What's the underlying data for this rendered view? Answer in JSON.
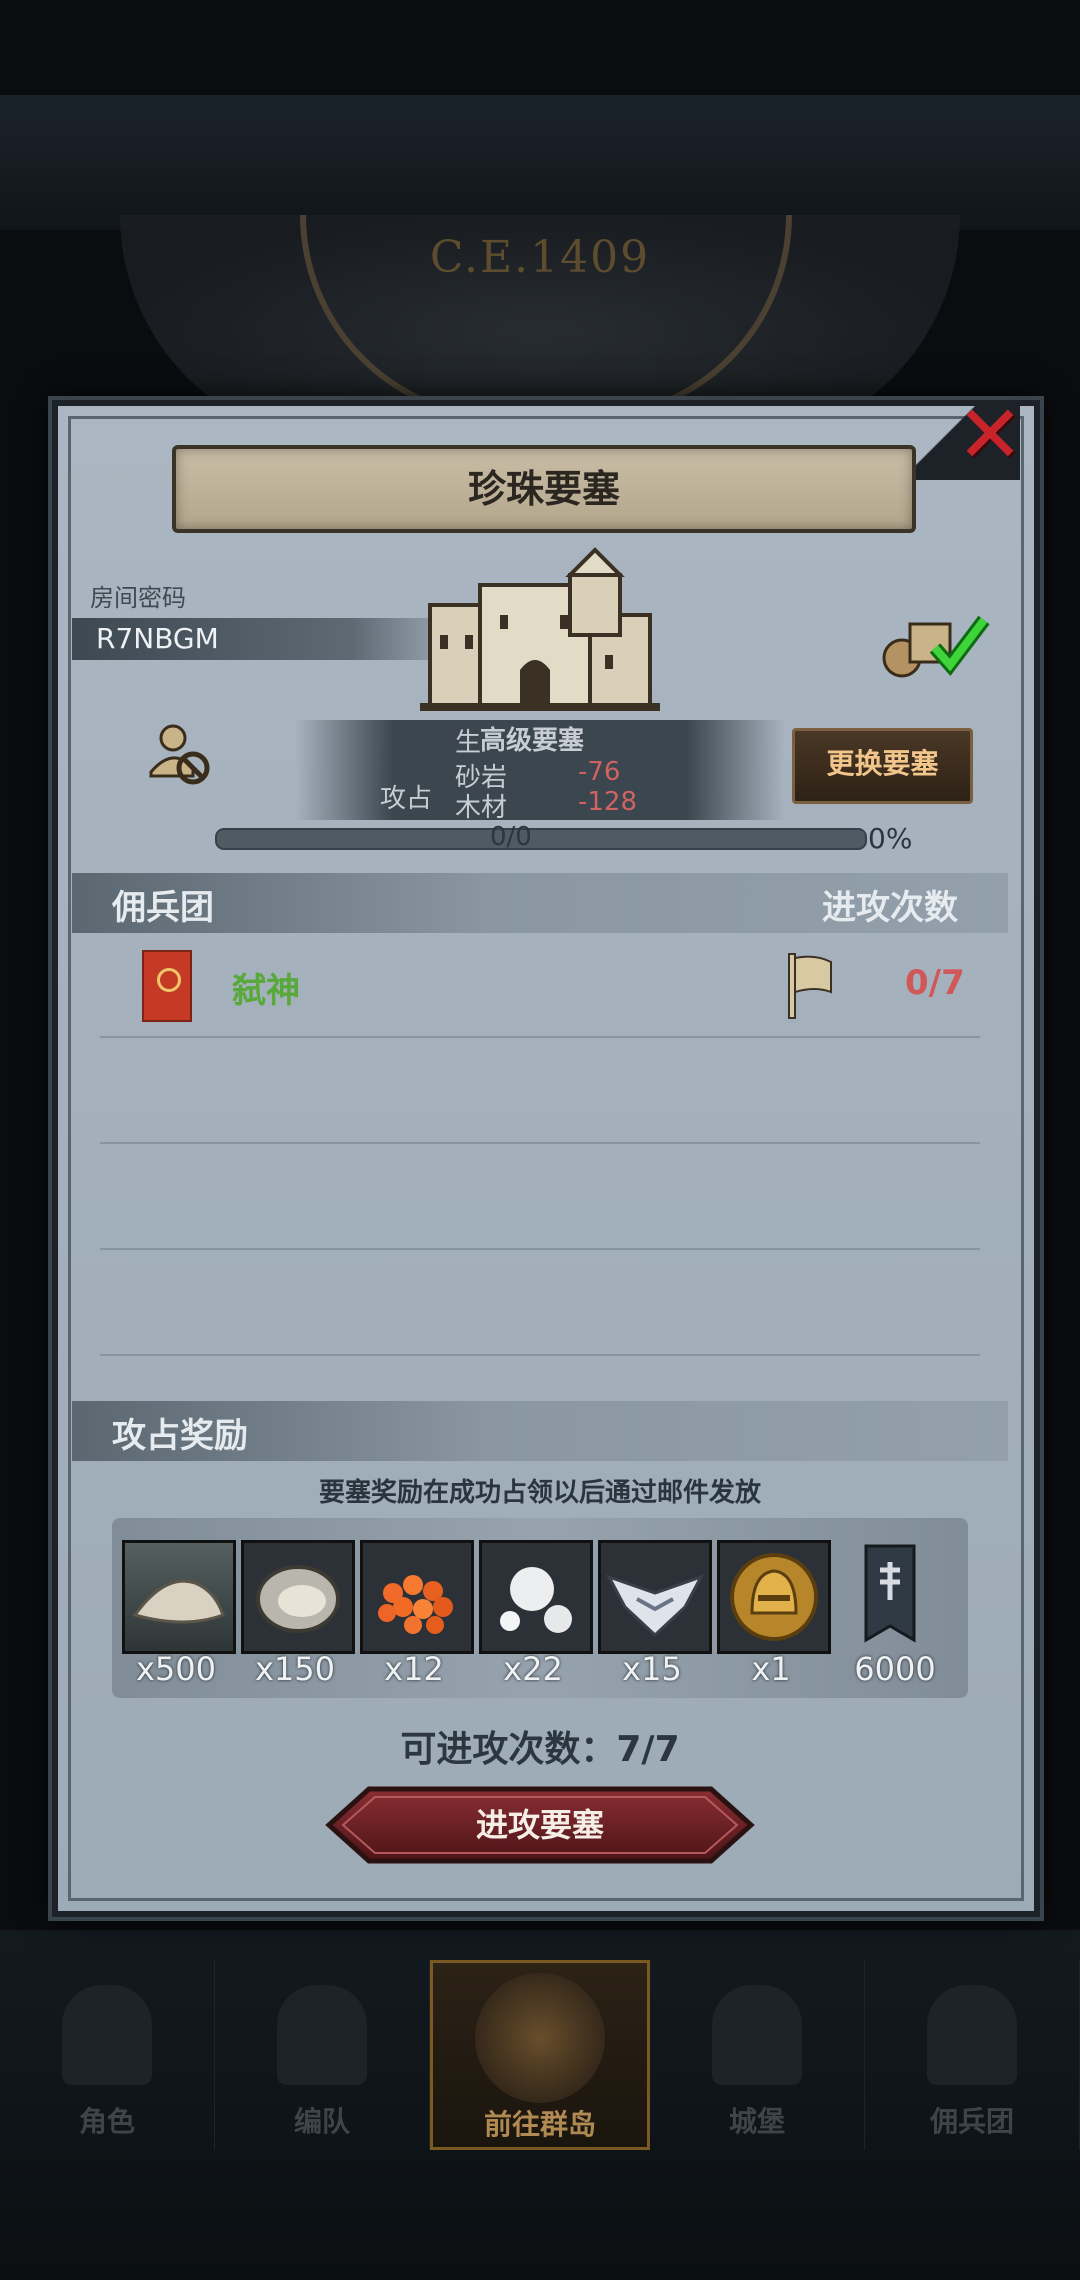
{
  "background": {
    "era_text": "C.E.1409"
  },
  "panel": {
    "title": "珍珠要塞",
    "room_label": "房间密码",
    "room_code": "R7NBGM",
    "fortress_level": "高级要塞",
    "info_lines": {
      "line1_prefix": "生",
      "line2_label": "砂岩",
      "line2_value": "-76",
      "line3_label": "木材",
      "line3_value": "-128",
      "overlay_text": "攻占"
    },
    "change_button": "更换要塞",
    "progress": {
      "text": "0/0",
      "percent_label": "0%",
      "fraction": 0
    },
    "mercenary_header": "佣兵团",
    "attack_count_header": "进攻次数",
    "guild": {
      "name": "弑神",
      "attacks": "0/7"
    },
    "reward_header": "攻占奖励",
    "reward_note": "要塞奖励在成功占领以后通过邮件发放",
    "rewards": [
      {
        "icon": "sand-icon",
        "qty": "x500"
      },
      {
        "icon": "oyster-icon",
        "qty": "x150"
      },
      {
        "icon": "fish-roe-icon",
        "qty": "x12"
      },
      {
        "icon": "pearl-icon",
        "qty": "x22"
      },
      {
        "icon": "wing-emblem-icon",
        "qty": "x15"
      },
      {
        "icon": "gold-helmet-icon",
        "qty": "x1"
      },
      {
        "icon": "guild-banner-icon",
        "qty": "6000"
      }
    ],
    "attempts_text": "可进攻次数：7/7",
    "attack_button": "进攻要塞"
  },
  "nav": {
    "items": [
      {
        "label": "角色",
        "icon": "knight-icon",
        "active": false
      },
      {
        "label": "编队",
        "icon": "armor-icon",
        "active": false
      },
      {
        "label": "前往群岛",
        "icon": "globe-icon",
        "active": true
      },
      {
        "label": "城堡",
        "icon": "castle-icon",
        "active": false
      },
      {
        "label": "佣兵团",
        "icon": "tower-icon",
        "active": false
      }
    ]
  },
  "colors": {
    "accent_red": "#c8232b",
    "guild_green": "#59a93a",
    "count_red": "#d05858",
    "button_gold": "#f2c58a"
  }
}
